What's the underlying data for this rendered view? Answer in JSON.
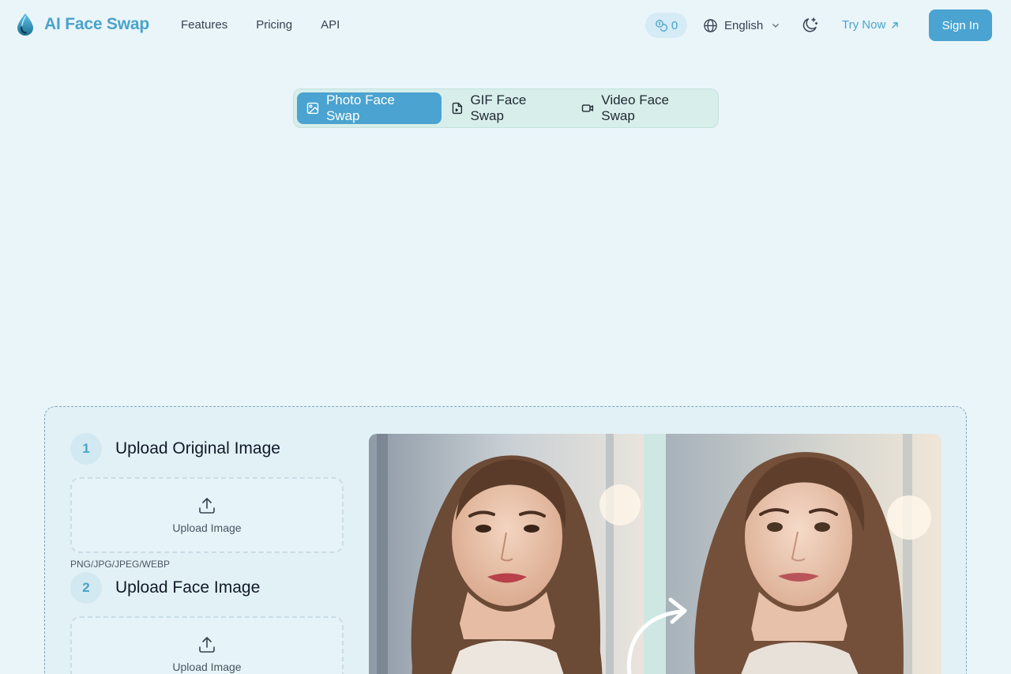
{
  "brand": {
    "name": "AI Face Swap",
    "logo_icon": "water-drop-icon",
    "accent": "#4aa3c9"
  },
  "nav": [
    {
      "label": "Features"
    },
    {
      "label": "Pricing"
    },
    {
      "label": "API"
    }
  ],
  "credits": {
    "count": "0",
    "icon": "coins-icon"
  },
  "language": {
    "selected": "English",
    "icon": "globe-icon"
  },
  "theme_toggle": {
    "icon": "moon-stars-icon"
  },
  "try_now": {
    "label": "Try Now",
    "icon": "arrow-up-right-icon"
  },
  "sign_in": {
    "label": "Sign In"
  },
  "modes": [
    {
      "label": "Photo Face Swap",
      "icon": "image-icon",
      "active": true
    },
    {
      "label": "GIF Face Swap",
      "icon": "file-icon",
      "active": false
    },
    {
      "label": "Video Face Swap",
      "icon": "video-icon",
      "active": false
    }
  ],
  "steps": [
    {
      "number": "1",
      "title": "Upload Original Image",
      "upload_label": "Upload Image"
    },
    {
      "number": "2",
      "title": "Upload Face Image",
      "upload_label": "Upload Image"
    }
  ],
  "formats": "PNG/JPG/JPEG/WEBP",
  "colors": {
    "background": "#eaf5fa",
    "primary_button": "#4aa3d0",
    "tabs_bg": "#d8eeea"
  }
}
